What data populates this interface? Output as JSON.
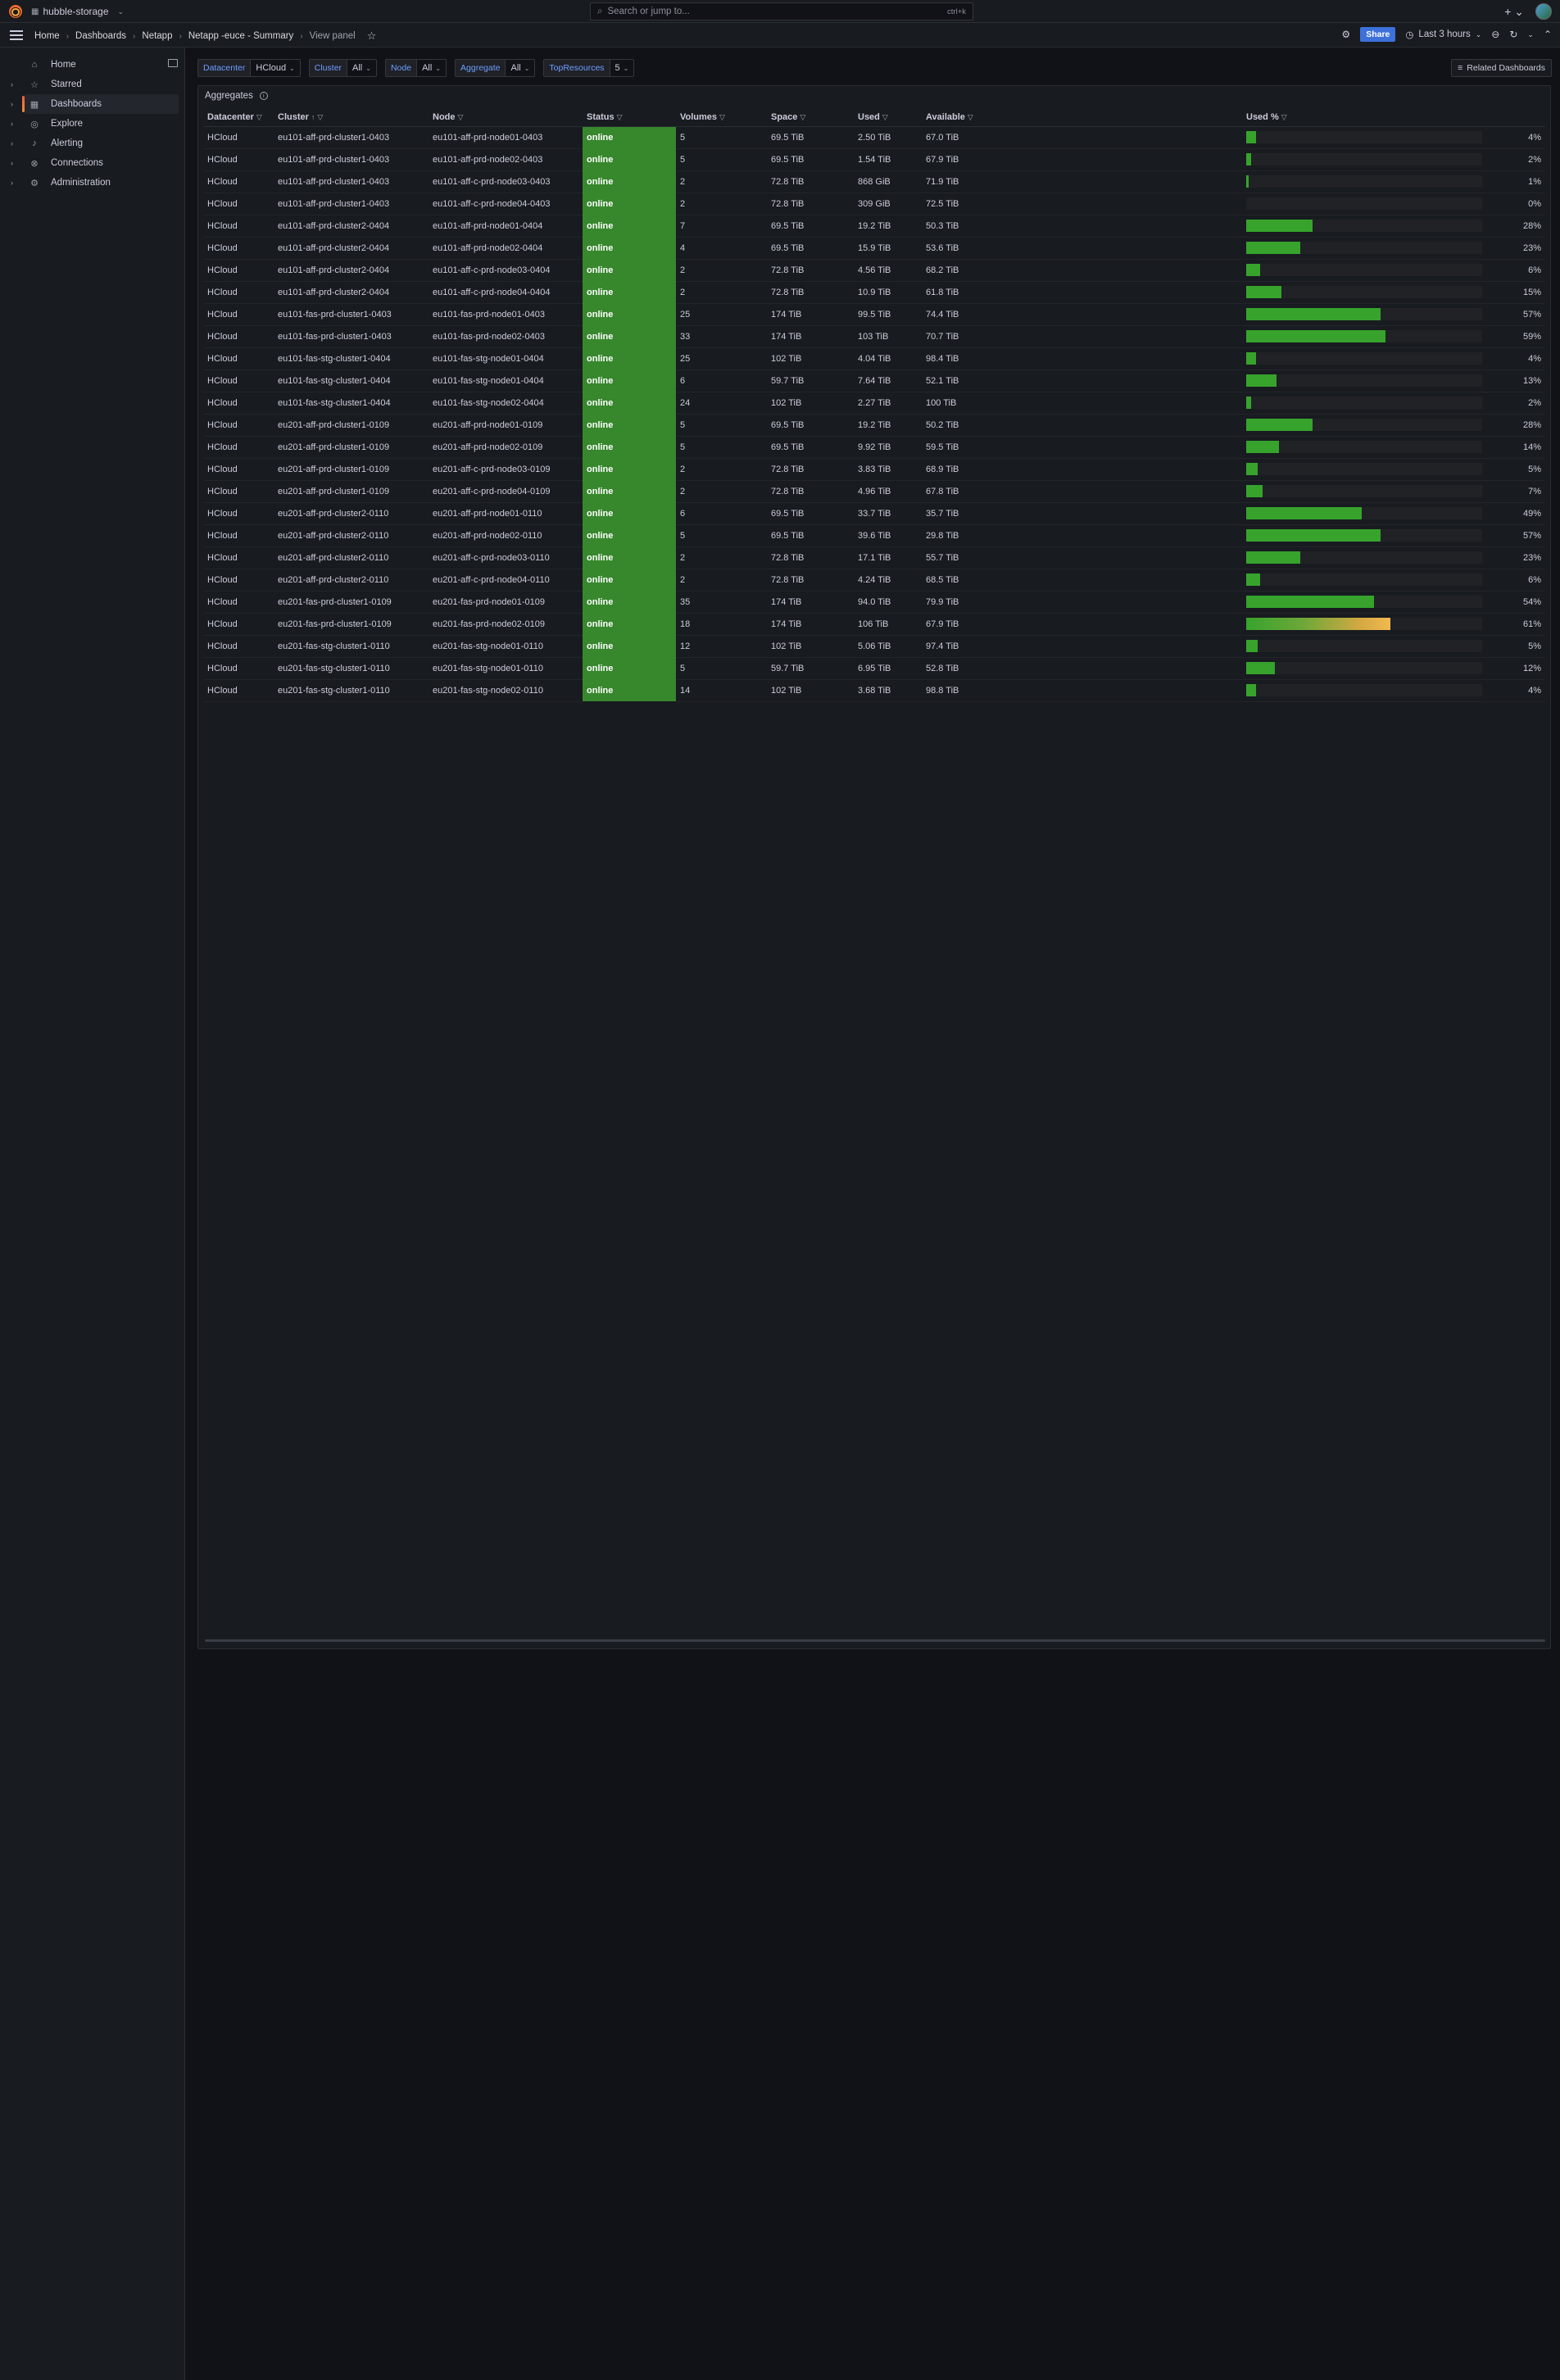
{
  "topbar": {
    "org": "hubble-storage",
    "search_placeholder": "Search or jump to...",
    "search_shortcut": "ctrl+k"
  },
  "breadcrumb": [
    "Home",
    "Dashboards",
    "Netapp",
    "Netapp -euce - Summary",
    "View panel"
  ],
  "toolbar": {
    "share_label": "Share",
    "time_range": "Last 3 hours"
  },
  "sidebar": {
    "items": [
      {
        "label": "Home",
        "icon": "home-icon"
      },
      {
        "label": "Starred",
        "icon": "star-icon"
      },
      {
        "label": "Dashboards",
        "icon": "dashboards-icon",
        "active": true
      },
      {
        "label": "Explore",
        "icon": "compass-icon"
      },
      {
        "label": "Alerting",
        "icon": "bell-icon"
      },
      {
        "label": "Connections",
        "icon": "connections-icon"
      },
      {
        "label": "Administration",
        "icon": "gear-icon"
      }
    ]
  },
  "variables": [
    {
      "label": "Datacenter",
      "value": "HCloud"
    },
    {
      "label": "Cluster",
      "value": "All"
    },
    {
      "label": "Node",
      "value": "All"
    },
    {
      "label": "Aggregate",
      "value": "All"
    },
    {
      "label": "TopResources",
      "value": "5"
    }
  ],
  "related_dashboards_label": "Related Dashboards",
  "panel": {
    "title": "Aggregates",
    "columns": [
      "Datacenter",
      "Cluster",
      "Node",
      "Status",
      "Volumes",
      "Space",
      "Used",
      "Available",
      "Used %"
    ],
    "rows": [
      [
        "HCloud",
        "eu101-aff-prd-cluster1-0403",
        "eu101-aff-prd-node01-0403",
        "online",
        "5",
        "69.5 TiB",
        "2.50 TiB",
        "67.0 TiB",
        "4%"
      ],
      [
        "HCloud",
        "eu101-aff-prd-cluster1-0403",
        "eu101-aff-prd-node02-0403",
        "online",
        "5",
        "69.5 TiB",
        "1.54 TiB",
        "67.9 TiB",
        "2%"
      ],
      [
        "HCloud",
        "eu101-aff-prd-cluster1-0403",
        "eu101-aff-c-prd-node03-0403",
        "online",
        "2",
        "72.8 TiB",
        "868 GiB",
        "71.9 TiB",
        "1%"
      ],
      [
        "HCloud",
        "eu101-aff-prd-cluster1-0403",
        "eu101-aff-c-prd-node04-0403",
        "online",
        "2",
        "72.8 TiB",
        "309 GiB",
        "72.5 TiB",
        "0%"
      ],
      [
        "HCloud",
        "eu101-aff-prd-cluster2-0404",
        "eu101-aff-prd-node01-0404",
        "online",
        "7",
        "69.5 TiB",
        "19.2 TiB",
        "50.3 TiB",
        "28%"
      ],
      [
        "HCloud",
        "eu101-aff-prd-cluster2-0404",
        "eu101-aff-prd-node02-0404",
        "online",
        "4",
        "69.5 TiB",
        "15.9 TiB",
        "53.6 TiB",
        "23%"
      ],
      [
        "HCloud",
        "eu101-aff-prd-cluster2-0404",
        "eu101-aff-c-prd-node03-0404",
        "online",
        "2",
        "72.8 TiB",
        "4.56 TiB",
        "68.2 TiB",
        "6%"
      ],
      [
        "HCloud",
        "eu101-aff-prd-cluster2-0404",
        "eu101-aff-c-prd-node04-0404",
        "online",
        "2",
        "72.8 TiB",
        "10.9 TiB",
        "61.8 TiB",
        "15%"
      ],
      [
        "HCloud",
        "eu101-fas-prd-cluster1-0403",
        "eu101-fas-prd-node01-0403",
        "online",
        "25",
        "174 TiB",
        "99.5 TiB",
        "74.4 TiB",
        "57%"
      ],
      [
        "HCloud",
        "eu101-fas-prd-cluster1-0403",
        "eu101-fas-prd-node02-0403",
        "online",
        "33",
        "174 TiB",
        "103 TiB",
        "70.7 TiB",
        "59%"
      ],
      [
        "HCloud",
        "eu101-fas-stg-cluster1-0404",
        "eu101-fas-stg-node01-0404",
        "online",
        "25",
        "102 TiB",
        "4.04 TiB",
        "98.4 TiB",
        "4%"
      ],
      [
        "HCloud",
        "eu101-fas-stg-cluster1-0404",
        "eu101-fas-stg-node01-0404",
        "online",
        "6",
        "59.7 TiB",
        "7.64 TiB",
        "52.1 TiB",
        "13%"
      ],
      [
        "HCloud",
        "eu101-fas-stg-cluster1-0404",
        "eu101-fas-stg-node02-0404",
        "online",
        "24",
        "102 TiB",
        "2.27 TiB",
        "100 TiB",
        "2%"
      ],
      [
        "HCloud",
        "eu201-aff-prd-cluster1-0109",
        "eu201-aff-prd-node01-0109",
        "online",
        "5",
        "69.5 TiB",
        "19.2 TiB",
        "50.2 TiB",
        "28%"
      ],
      [
        "HCloud",
        "eu201-aff-prd-cluster1-0109",
        "eu201-aff-prd-node02-0109",
        "online",
        "5",
        "69.5 TiB",
        "9.92 TiB",
        "59.5 TiB",
        "14%"
      ],
      [
        "HCloud",
        "eu201-aff-prd-cluster1-0109",
        "eu201-aff-c-prd-node03-0109",
        "online",
        "2",
        "72.8 TiB",
        "3.83 TiB",
        "68.9 TiB",
        "5%"
      ],
      [
        "HCloud",
        "eu201-aff-prd-cluster1-0109",
        "eu201-aff-c-prd-node04-0109",
        "online",
        "2",
        "72.8 TiB",
        "4.96 TiB",
        "67.8 TiB",
        "7%"
      ],
      [
        "HCloud",
        "eu201-aff-prd-cluster2-0110",
        "eu201-aff-prd-node01-0110",
        "online",
        "6",
        "69.5 TiB",
        "33.7 TiB",
        "35.7 TiB",
        "49%"
      ],
      [
        "HCloud",
        "eu201-aff-prd-cluster2-0110",
        "eu201-aff-prd-node02-0110",
        "online",
        "5",
        "69.5 TiB",
        "39.6 TiB",
        "29.8 TiB",
        "57%"
      ],
      [
        "HCloud",
        "eu201-aff-prd-cluster2-0110",
        "eu201-aff-c-prd-node03-0110",
        "online",
        "2",
        "72.8 TiB",
        "17.1 TiB",
        "55.7 TiB",
        "23%"
      ],
      [
        "HCloud",
        "eu201-aff-prd-cluster2-0110",
        "eu201-aff-c-prd-node04-0110",
        "online",
        "2",
        "72.8 TiB",
        "4.24 TiB",
        "68.5 TiB",
        "6%"
      ],
      [
        "HCloud",
        "eu201-fas-prd-cluster1-0109",
        "eu201-fas-prd-node01-0109",
        "online",
        "35",
        "174 TiB",
        "94.0 TiB",
        "79.9 TiB",
        "54%"
      ],
      [
        "HCloud",
        "eu201-fas-prd-cluster1-0109",
        "eu201-fas-prd-node02-0109",
        "online",
        "18",
        "174 TiB",
        "106 TiB",
        "67.9 TiB",
        "61%"
      ],
      [
        "HCloud",
        "eu201-fas-stg-cluster1-0110",
        "eu201-fas-stg-node01-0110",
        "online",
        "12",
        "102 TiB",
        "5.06 TiB",
        "97.4 TiB",
        "5%"
      ],
      [
        "HCloud",
        "eu201-fas-stg-cluster1-0110",
        "eu201-fas-stg-node01-0110",
        "online",
        "5",
        "59.7 TiB",
        "6.95 TiB",
        "52.8 TiB",
        "12%"
      ],
      [
        "HCloud",
        "eu201-fas-stg-cluster1-0110",
        "eu201-fas-stg-node02-0110",
        "online",
        "14",
        "102 TiB",
        "3.68 TiB",
        "98.8 TiB",
        "4%"
      ]
    ]
  },
  "colors": {
    "status_online": "#37872d",
    "gauge_green": "#37a32d",
    "gauge_warn": "#f2b950",
    "share": "#3d71d9"
  }
}
